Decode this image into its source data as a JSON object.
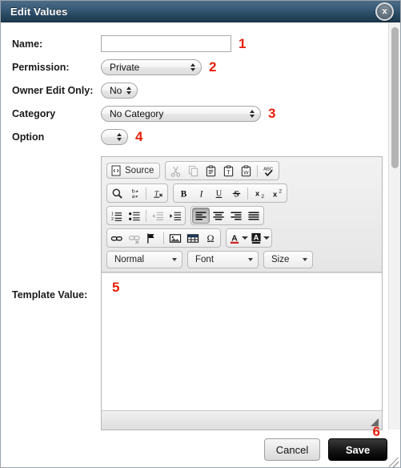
{
  "window": {
    "title": "Edit Values",
    "close_label": "x"
  },
  "form": {
    "name": {
      "label": "Name:",
      "value": "",
      "placeholder": "",
      "marker": "1"
    },
    "permission": {
      "label": "Permission:",
      "value": "Private",
      "marker": "2"
    },
    "owner_edit_only": {
      "label": "Owner Edit Only:",
      "value": "No",
      "marker": ""
    },
    "category": {
      "label": "Category",
      "value": "No Category",
      "marker": "3"
    },
    "option": {
      "label": "Option",
      "value": "",
      "marker": "4"
    },
    "template_value": {
      "label": "Template Value:",
      "value": "",
      "marker": "5"
    }
  },
  "editor": {
    "source_button": "Source",
    "toolbar_row1": [
      {
        "name": "cut-icon",
        "title": "Cut",
        "disabled": true
      },
      {
        "name": "copy-icon",
        "title": "Copy",
        "disabled": true
      },
      {
        "name": "paste-icon",
        "title": "Paste",
        "disabled": false
      },
      {
        "name": "paste-as-text-icon",
        "title": "Paste as plain text",
        "disabled": false
      },
      {
        "name": "paste-from-word-icon",
        "title": "Paste from Word",
        "disabled": false
      },
      {
        "name": "spellcheck-icon",
        "title": "Check Spelling",
        "disabled": false
      }
    ],
    "toolbar_row2_left": [
      {
        "name": "find-icon",
        "title": "Find",
        "disabled": false
      },
      {
        "name": "replace-icon",
        "title": "Replace",
        "disabled": false
      },
      {
        "name": "remove-format-icon",
        "title": "Remove Format",
        "disabled": false
      }
    ],
    "toolbar_row2_right": [
      {
        "name": "bold-icon",
        "title": "Bold",
        "disabled": false
      },
      {
        "name": "italic-icon",
        "title": "Italic",
        "disabled": false
      },
      {
        "name": "underline-icon",
        "title": "Underline",
        "disabled": false
      },
      {
        "name": "strikethrough-icon",
        "title": "Strike Through",
        "disabled": false
      },
      {
        "name": "subscript-icon",
        "title": "Subscript",
        "disabled": false
      },
      {
        "name": "superscript-icon",
        "title": "Superscript",
        "disabled": false
      }
    ],
    "toolbar_row3_lists": [
      {
        "name": "numbered-list-icon",
        "title": "Insert/Remove Numbered List",
        "disabled": false
      },
      {
        "name": "bulleted-list-icon",
        "title": "Insert/Remove Bulleted List",
        "disabled": false
      },
      {
        "name": "outdent-icon",
        "title": "Decrease Indent",
        "disabled": true
      },
      {
        "name": "indent-icon",
        "title": "Increase Indent",
        "disabled": false
      }
    ],
    "toolbar_row3_align": [
      {
        "name": "align-left-icon",
        "title": "Align Left",
        "active": true
      },
      {
        "name": "align-center-icon",
        "title": "Center",
        "active": false
      },
      {
        "name": "align-right-icon",
        "title": "Align Right",
        "active": false
      },
      {
        "name": "align-justify-icon",
        "title": "Justify",
        "active": false
      }
    ],
    "toolbar_row4_insert": [
      {
        "name": "link-icon",
        "title": "Link",
        "disabled": false
      },
      {
        "name": "unlink-icon",
        "title": "Unlink",
        "disabled": true
      },
      {
        "name": "anchor-icon",
        "title": "Anchor",
        "disabled": false
      },
      {
        "name": "image-icon",
        "title": "Image",
        "disabled": false
      },
      {
        "name": "table-icon",
        "title": "Table",
        "disabled": false
      },
      {
        "name": "special-char-icon",
        "title": "Insert Special Character",
        "disabled": false
      }
    ],
    "toolbar_row4_colors": [
      {
        "name": "text-color-icon",
        "title": "Text Color"
      },
      {
        "name": "background-color-icon",
        "title": "Background Color"
      }
    ],
    "format_dropdown": "Normal",
    "font_dropdown": "Font",
    "size_dropdown": "Size",
    "content": ""
  },
  "footer": {
    "cancel_label": "Cancel",
    "save_label": "Save",
    "marker": "6"
  },
  "colors": {
    "titlebar_dark": "#1d3a50",
    "titlebar_light": "#4c6b86",
    "marker_red": "#e81f09",
    "save_black": "#000000"
  }
}
